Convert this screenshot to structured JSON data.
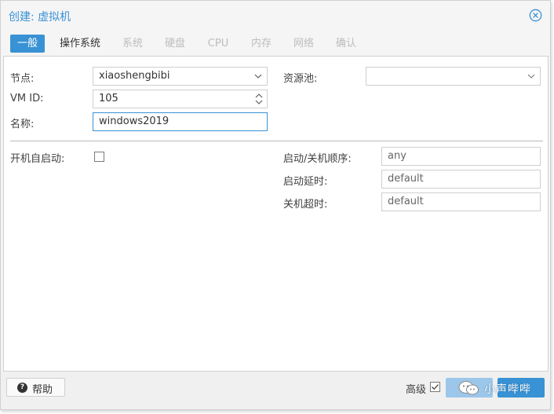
{
  "window": {
    "title": "创建: 虚拟机"
  },
  "tabs": [
    {
      "label": "一般"
    },
    {
      "label": "操作系统"
    },
    {
      "label": "系统"
    },
    {
      "label": "硬盘"
    },
    {
      "label": "CPU"
    },
    {
      "label": "内存"
    },
    {
      "label": "网络"
    },
    {
      "label": "确认"
    }
  ],
  "form": {
    "node_label": "节点:",
    "node_value": "xiaoshengbibi",
    "vmid_label": "VM ID:",
    "vmid_value": "105",
    "name_label": "名称:",
    "name_value": "windows2019",
    "pool_label": "资源池:",
    "pool_value": "",
    "onboot_label": "开机自启动:",
    "onboot_checked": false,
    "order_label": "启动/关机顺序:",
    "order_value": "any",
    "startup_delay_label": "启动延时:",
    "startup_delay_value": "default",
    "shutdown_timeout_label": "关机超时:",
    "shutdown_timeout_value": "default"
  },
  "footer": {
    "help_label": "帮助",
    "advanced_label": "高级",
    "advanced_checked": true,
    "watermark_text": "小声哔哔"
  },
  "colors": {
    "accent": "#3892d4",
    "panel_bg": "#ffffff",
    "chrome_bg": "#f5f5f5"
  }
}
